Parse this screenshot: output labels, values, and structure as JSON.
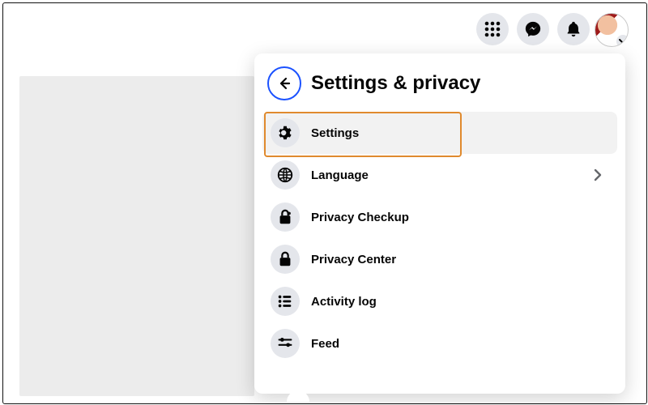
{
  "header": {
    "title": "Settings & privacy"
  },
  "menu": {
    "items": [
      {
        "label": "Settings"
      },
      {
        "label": "Language"
      },
      {
        "label": "Privacy Checkup"
      },
      {
        "label": "Privacy Center"
      },
      {
        "label": "Activity log"
      },
      {
        "label": "Feed"
      }
    ]
  }
}
